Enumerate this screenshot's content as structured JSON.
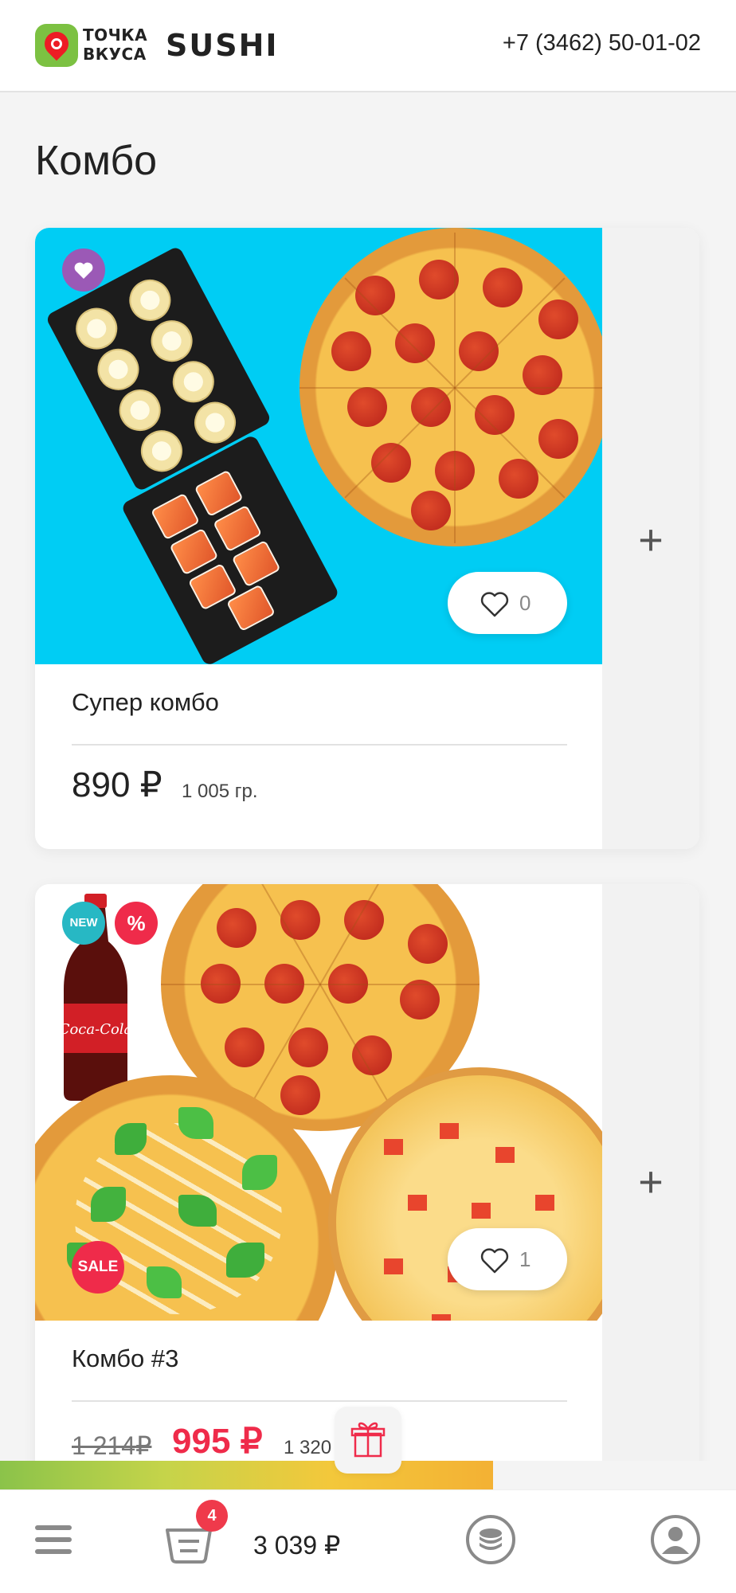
{
  "header": {
    "logo_line1": "ТОЧКА",
    "logo_line2": "ВКУСА",
    "logo_sushi": "SUSHI",
    "phone": "+7 (3462) 50-01-02"
  },
  "page": {
    "title": "Комбо"
  },
  "products": [
    {
      "name": "Супер комбо",
      "price": "890 ₽",
      "weight": "1 005 гр.",
      "likes": "0",
      "favorite": true
    },
    {
      "name": "Комбо #3",
      "old_price": "1 214₽",
      "price": "995 ₽",
      "weight": "1 320",
      "likes": "1",
      "badges": [
        "NEW",
        "%",
        "SALE"
      ]
    }
  ],
  "bottom": {
    "cart_count": "4",
    "cart_total": "3 039 ₽",
    "progress_fraction": 0.67
  },
  "colors": {
    "accent_cyan": "#00cdf4",
    "sale_red": "#ef2b4a",
    "purple": "#9b59b6",
    "teal": "#27b8c4",
    "brand_green": "#7cc142"
  }
}
